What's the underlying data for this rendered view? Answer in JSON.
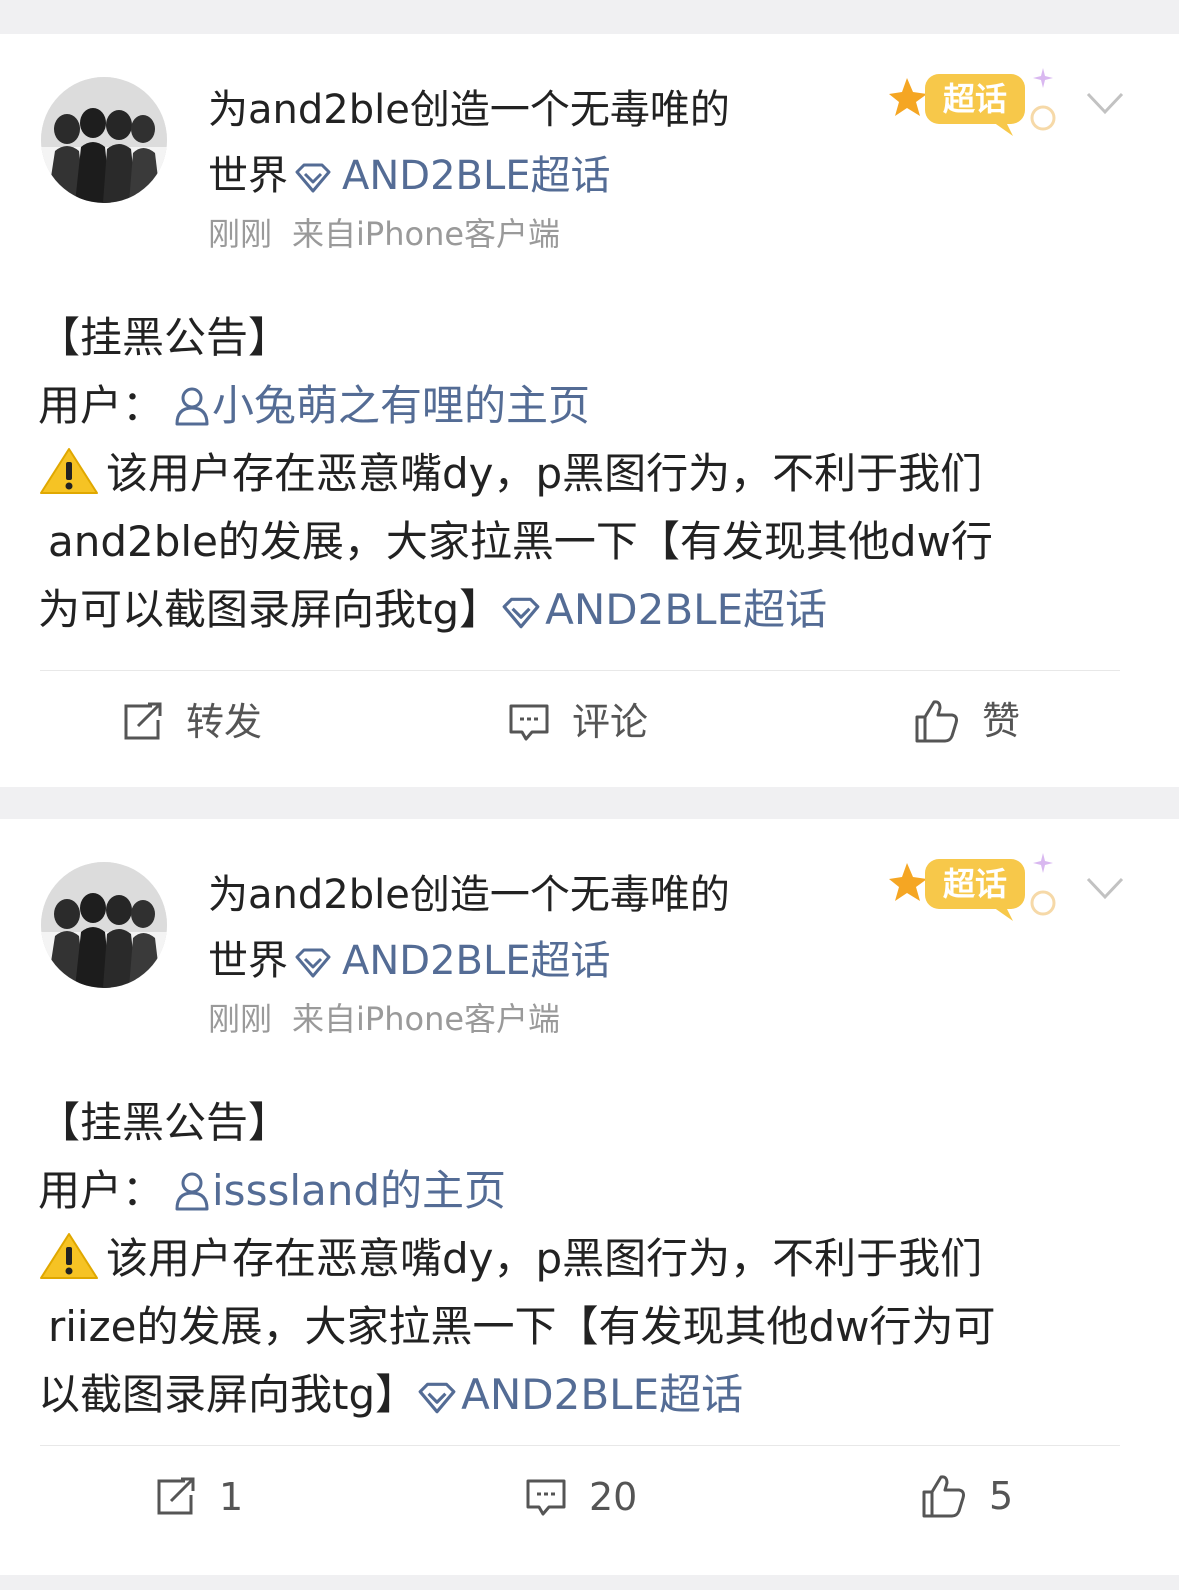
{
  "posts": [
    {
      "author_line1": "为and2ble创造一个无毒唯的",
      "author_line2_prefix": "世界",
      "supertopic_link": "AND2BLE超话",
      "time": "刚刚",
      "source": "来自iPhone客户端",
      "badge_text": "超话",
      "title": "【挂黑公告】",
      "user_prefix": "用户：",
      "user_link": "小兔萌之有哩的主页",
      "body_line1": "该用户存在恶意嘴dy，p黑图行为，不利于我们",
      "body_line2": "and2ble的发展，大家拉黑一下【有发现其他dw行",
      "body_line3": "为可以截图录屏向我tg】",
      "body_topic": "AND2BLE超话",
      "repost_label": "转发",
      "comment_label": "评论",
      "like_label": "赞"
    },
    {
      "author_line1": "为and2ble创造一个无毒唯的",
      "author_line2_prefix": "世界",
      "supertopic_link": "AND2BLE超话",
      "time": "刚刚",
      "source": "来自iPhone客户端",
      "badge_text": "超话",
      "title": "【挂黑公告】",
      "user_prefix": "用户：",
      "user_link": "isssland的主页",
      "body_line1": "该用户存在恶意嘴dy，p黑图行为，不利于我们",
      "body_line2": "riize的发展，大家拉黑一下【有发现其他dw行为可",
      "body_line3": "以截图录屏向我tg】",
      "body_topic": "AND2BLE超话",
      "repost_label": "1",
      "comment_label": "20",
      "like_label": "5"
    }
  ],
  "colors": {
    "link": "#546c95",
    "badge": "#f7c84a",
    "background": "#f0f0f2"
  },
  "icons": [
    "gem-icon",
    "user-icon",
    "warning-icon",
    "repost-icon",
    "comment-icon",
    "like-icon",
    "chevron-down-icon",
    "supertopic-badge-icon"
  ]
}
